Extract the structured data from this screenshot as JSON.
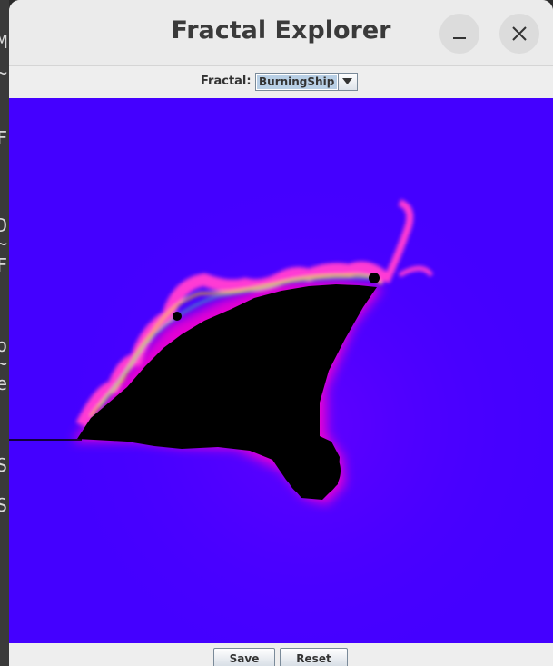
{
  "window": {
    "title": "Fractal Explorer",
    "minimize_icon": "minimize-icon",
    "close_icon": "close-icon"
  },
  "toolbar": {
    "fractal_label": "Fractal:",
    "fractal_selected": "BurningShip",
    "dropdown_icon": "chevron-down-icon"
  },
  "canvas": {
    "fractal": "BurningShip",
    "background_color": "#4400ff",
    "set_color": "#000000",
    "edge_color": "#ff00cc"
  },
  "buttons": {
    "save_label": "Save",
    "reset_label": "Reset"
  },
  "background": {
    "glyphs": [
      "M",
      "~",
      "F",
      "D",
      "~",
      "F",
      "o",
      "~",
      "e",
      "S",
      "S"
    ]
  }
}
